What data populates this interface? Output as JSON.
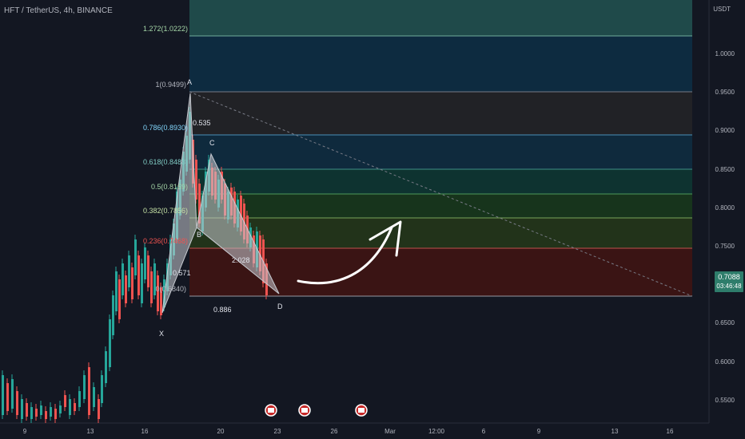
{
  "header": {
    "symbol": "HFT / TetherUS, 4h, BINANCE"
  },
  "axis": {
    "currency": "USDT",
    "price_ticks": [
      "1.0000",
      "0.9500",
      "0.9000",
      "0.8500",
      "0.8000",
      "0.7500",
      "0.6500",
      "0.6000",
      "0.5500"
    ],
    "time_ticks": [
      "9",
      "13",
      "16",
      "20",
      "23",
      "26",
      "Mar",
      "12:00",
      "6",
      "9",
      "13",
      "16"
    ]
  },
  "last_price": {
    "value": "0.7088",
    "countdown": "03:46:48"
  },
  "fib_levels": [
    {
      "label": "1.272(1.0222)",
      "color": "#a5d6a7"
    },
    {
      "label": "1(0.9499)",
      "color": "#b2b5be"
    },
    {
      "label": "0.786(0.8930)",
      "color": "#81d4fa"
    },
    {
      "label": "0.618(0.8483)",
      "color": "#80cbc4"
    },
    {
      "label": "0.5(0.8169)",
      "color": "#a5d6a7"
    },
    {
      "label": "0.382(0.7856)",
      "color": "#c5e1a5"
    },
    {
      "label": "0.236(0.7468)",
      "color": "#ef5350"
    },
    {
      "label": "0(0.6840)",
      "color": "#b2b5be"
    }
  ],
  "pattern": {
    "points": [
      "X",
      "A",
      "B",
      "C",
      "D"
    ],
    "ratios": [
      "0.535",
      "0.571",
      "2.028",
      "0.886"
    ]
  },
  "colors": {
    "up": "#26a69a",
    "down": "#ef5350",
    "background": "#131722"
  }
}
